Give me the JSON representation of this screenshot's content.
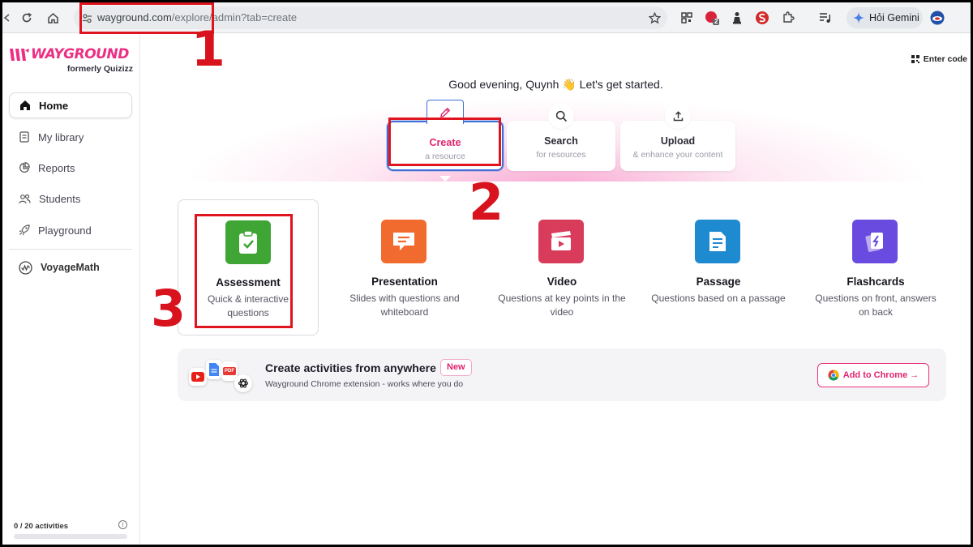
{
  "browser": {
    "url_domain": "wayground.com",
    "url_path": "/explore/admin?tab=create",
    "gemini_label": "Hỏi Gemini",
    "extension_badge": "2"
  },
  "sidebar": {
    "logo_text": "WAYGROUND",
    "logo_subtitle": "formerly Quizizz",
    "nav": [
      {
        "label": "Home",
        "icon": "home-icon",
        "active": true
      },
      {
        "label": "My library",
        "icon": "library-icon"
      },
      {
        "label": "Reports",
        "icon": "reports-icon"
      },
      {
        "label": "Students",
        "icon": "students-icon"
      },
      {
        "label": "Playground",
        "icon": "rocket-icon"
      }
    ],
    "voyage_label": "VoyageMath",
    "activity_count": "0 / 20 activities",
    "activity_progress": 0
  },
  "header": {
    "enter_code": "Enter code",
    "greeting": "Good evening, Quynh 👋 Let's get started."
  },
  "modes": [
    {
      "title": "Create",
      "subtitle": "a resource",
      "icon": "pencil-icon",
      "selected": true
    },
    {
      "title": "Search",
      "subtitle": "for resources",
      "icon": "search-icon"
    },
    {
      "title": "Upload",
      "subtitle": "& enhance your content",
      "icon": "upload-icon"
    }
  ],
  "resource_types": [
    {
      "title": "Assessment",
      "description": "Quick & interactive questions",
      "color": "#3fa535"
    },
    {
      "title": "Presentation",
      "description": "Slides with questions and whiteboard",
      "color": "#f06b2d"
    },
    {
      "title": "Video",
      "description": "Questions at key points in the video",
      "color": "#d93b5a"
    },
    {
      "title": "Passage",
      "description": "Questions based on a passage",
      "color": "#1e8ad0"
    },
    {
      "title": "Flashcards",
      "description": "Questions on front, answers on back",
      "color": "#6a4be0"
    }
  ],
  "promo": {
    "title": "Create activities from anywhere",
    "badge": "New",
    "subtitle": "Wayground Chrome extension - works where you do",
    "button": "Add to Chrome →",
    "pdf_label": "PDF"
  },
  "annotations": [
    "1",
    "2",
    "3"
  ],
  "colors": {
    "brand_pink": "#ec2f84",
    "annotation_red": "#e0141e",
    "selection_blue": "#3e6fd8"
  }
}
